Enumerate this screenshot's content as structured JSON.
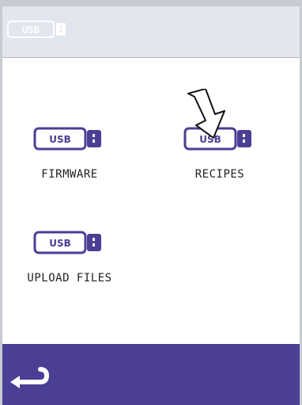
{
  "header": {
    "usb_badge": "USB"
  },
  "items": [
    {
      "label": "FIRMWARE",
      "usb": "USB"
    },
    {
      "label": "RECIPES",
      "usb": "USB"
    },
    {
      "label": "UPLOAD FILES",
      "usb": "USB"
    }
  ],
  "footer": {
    "back_icon": "return-arrow"
  },
  "colors": {
    "accent": "#4a3f95",
    "header_bg": "#e2e6ee",
    "usb_fill": "#4a3f95"
  }
}
